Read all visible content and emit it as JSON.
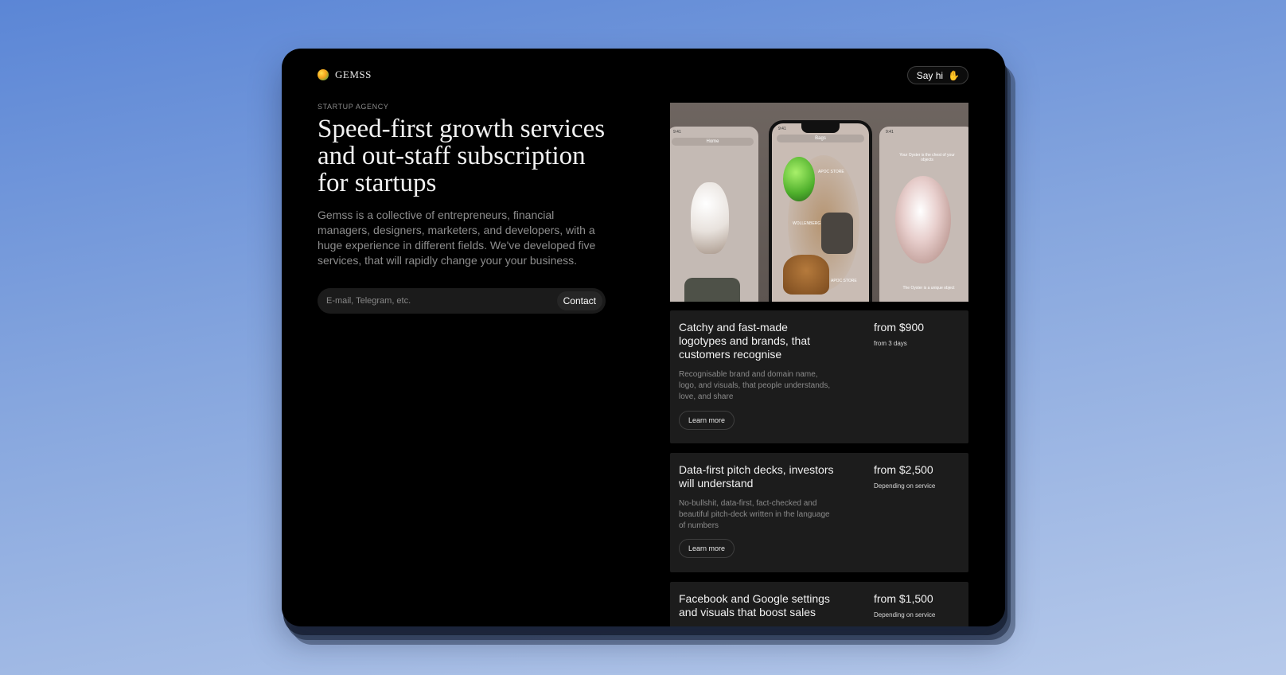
{
  "brand": {
    "name": "GEMSS"
  },
  "header": {
    "say_hi": "Say hi"
  },
  "hero": {
    "kicker": "STARTUP AGENCY",
    "headline": "Speed-first growth services and out-staff subscription for startups",
    "intro": "Gemss is a collective of entrepreneurs, financial managers, designers, marketers, and developers, with a huge experience in different fields. We've developed five services, that will rapidly change your your business."
  },
  "contact": {
    "placeholder": "E-mail, Telegram, etc.",
    "button": "Contact"
  },
  "showcase": {
    "phone1": {
      "time": "9:41",
      "title": "Home"
    },
    "phone2": {
      "time": "9:41",
      "title": "Bags",
      "tag1": "APOC STORE",
      "tag2": "WOLLENBERG",
      "tag3": "APOC STORE"
    },
    "phone3": {
      "time": "9:41",
      "caption": "Your Oyster is the chest of your objects",
      "footer": "The Oyster is a unique object"
    }
  },
  "services": [
    {
      "title": "Catchy and fast-made logotypes and brands, that customers recognise",
      "description": "Recognisable brand and domain name, logo, and visuals, that people understands, love, and share",
      "price": "from $900",
      "note": "from 3 days",
      "cta": "Learn more"
    },
    {
      "title": "Data-first pitch decks, investors will understand",
      "description": "No-bullshit, data-first, fact-checked and beautiful pitch-deck written in the language of numbers",
      "price": "from $2,500",
      "note": "Depending on service",
      "cta": "Learn more"
    },
    {
      "title": "Facebook and Google settings and visuals that boost sales",
      "price": "from $1,500",
      "note": "Depending on service"
    }
  ]
}
